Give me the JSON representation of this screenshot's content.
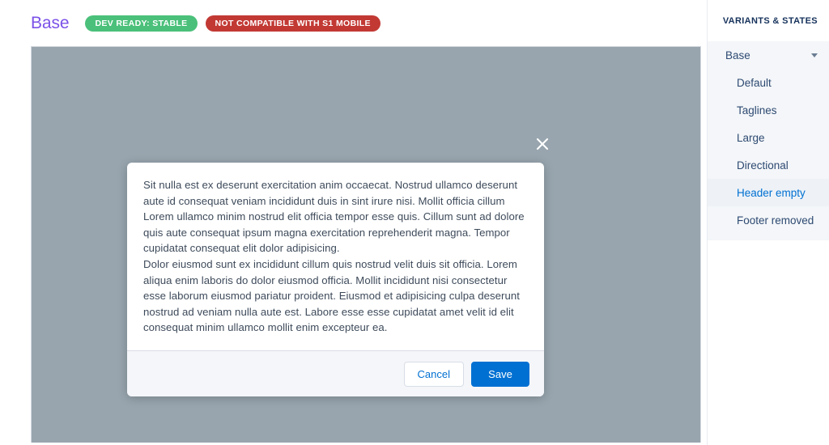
{
  "header": {
    "title": "Base",
    "badges": [
      {
        "label": "DEV READY: STABLE",
        "color": "#4bc07a"
      },
      {
        "label": "NOT COMPATIBLE WITH S1 MOBILE",
        "color": "#c23934"
      }
    ]
  },
  "modal": {
    "close_icon": "close-icon",
    "paragraphs": [
      "Sit nulla est ex deserunt exercitation anim occaecat. Nostrud ullamco deserunt aute id consequat veniam incididunt duis in sint irure nisi. Mollit officia cillum Lorem ullamco minim nostrud elit officia tempor esse quis. Cillum sunt ad dolore quis aute consequat ipsum magna exercitation reprehenderit magna. Tempor cupidatat consequat elit dolor adipisicing.",
      "Dolor eiusmod sunt ex incididunt cillum quis nostrud velit duis sit officia. Lorem aliqua enim laboris do dolor eiusmod officia. Mollit incididunt nisi consectetur esse laborum eiusmod pariatur proident. Eiusmod et adipisicing culpa deserunt nostrud ad veniam nulla aute est. Labore esse esse cupidatat amet velit id elit consequat minim ullamco mollit enim excepteur ea."
    ],
    "cancel_label": "Cancel",
    "save_label": "Save",
    "accent_color": "#0070d2"
  },
  "sidebar": {
    "header_label": "VARIANTS & STATES",
    "items": [
      {
        "label": "Base",
        "type": "group",
        "icon": "chevron-down-icon",
        "active": false
      },
      {
        "label": "Default",
        "type": "child",
        "active": false
      },
      {
        "label": "Taglines",
        "type": "child",
        "active": false
      },
      {
        "label": "Large",
        "type": "child",
        "active": false
      },
      {
        "label": "Directional",
        "type": "child",
        "active": false
      },
      {
        "label": "Header empty",
        "type": "child",
        "active": true
      },
      {
        "label": "Footer removed",
        "type": "child",
        "active": false
      }
    ]
  }
}
